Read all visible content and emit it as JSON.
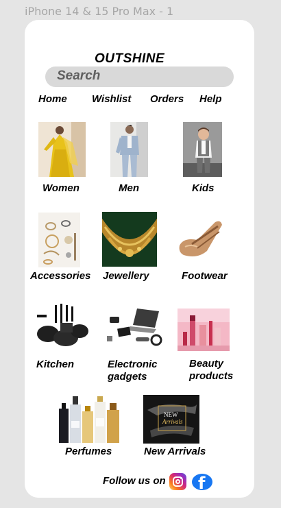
{
  "frame": {
    "label": "iPhone 14 & 15 Pro Max - 1"
  },
  "header": {
    "title": "OUTSHINE"
  },
  "search": {
    "placeholder": "Search"
  },
  "nav": {
    "items": [
      "Home",
      "Wishlist",
      "Orders",
      "Help"
    ]
  },
  "categories": [
    {
      "label": "Women"
    },
    {
      "label": "Men"
    },
    {
      "label": "Kids"
    },
    {
      "label": "Accessories"
    },
    {
      "label": "Jewellery"
    },
    {
      "label": "Footwear"
    },
    {
      "label": "Kitchen"
    },
    {
      "label": "Electronic gadgets"
    },
    {
      "label": "Beauty products"
    },
    {
      "label": "Perfumes"
    },
    {
      "label": "New Arrivals"
    }
  ],
  "banner": {
    "line1": "NEW",
    "line2": "Arrivals"
  },
  "footer": {
    "follow_text": "Follow us on",
    "social": [
      "instagram-icon",
      "facebook-icon"
    ],
    "fb_glyph": "f"
  },
  "colors": {
    "background": "#e5e5e5",
    "card": "#ffffff",
    "search_bg": "#d9d9d9",
    "facebook": "#1877f2"
  }
}
